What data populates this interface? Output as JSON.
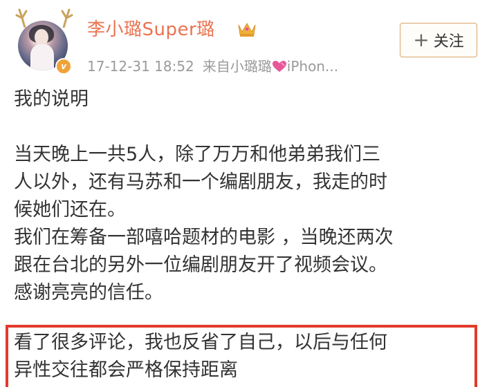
{
  "post": {
    "username": "李小璐Super璐",
    "timestamp": "17-12-31 18:52",
    "source": "来自小璐璐",
    "device": "iPhon...",
    "follow_label": "关注",
    "follow_plus": "+",
    "verified_badge": "v"
  },
  "content": {
    "title": "我的说明",
    "paragraph1_lines": [
      "当天晚上一共5人，除了万万和他弟弟我们三",
      "人以外，还有马苏和一个编剧朋友，我走的时",
      "候她们还在。"
    ],
    "paragraph2_lines": [
      "我们在筹备一部嘻哈题材的电影 ，当晚还两次",
      "跟在台北的另外一位编剧朋友开了视频会议。"
    ],
    "paragraph3": "感谢亮亮的信任。",
    "highlight_lines": [
      "看了很多评论，我也反省了自己，以后与任何",
      "异性交往都会严格保持距离"
    ]
  },
  "icons": {
    "crown": "crown-icon",
    "heart": "heart-icon",
    "antlers": "antler-icon",
    "plus": "plus-icon"
  },
  "colors": {
    "username": "#eb7350",
    "meta": "#9a9a9a",
    "highlight_border": "#e23a2c",
    "follow_border": "#d9a66a",
    "crown": "#f0b23a",
    "heart": "#e8579a"
  }
}
